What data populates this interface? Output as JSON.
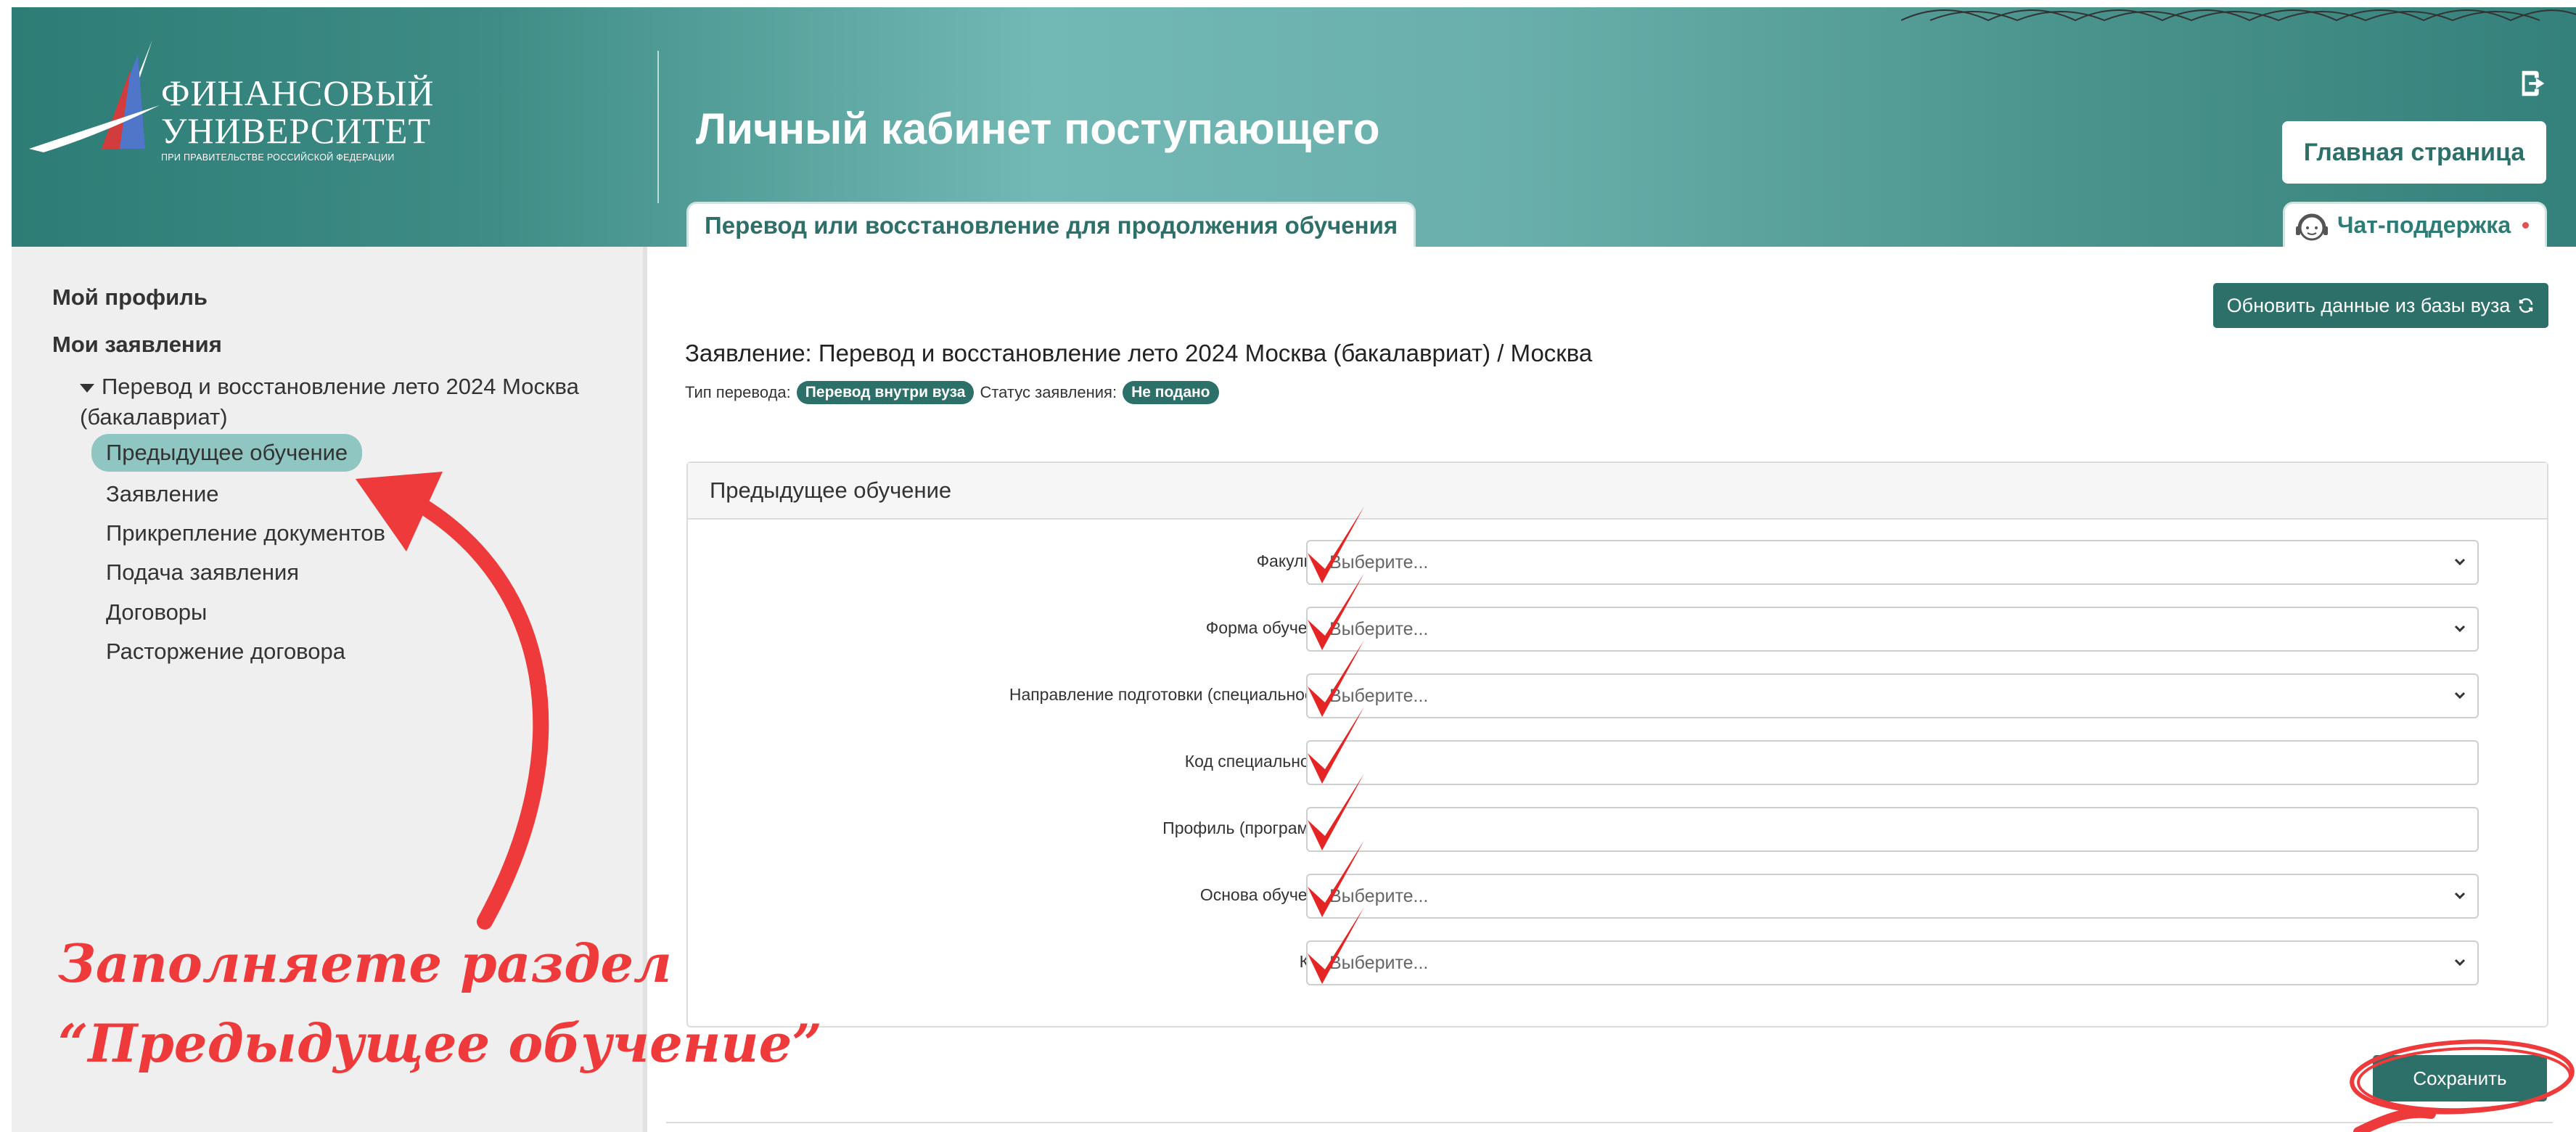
{
  "header": {
    "logo_line1": "ФИНАНСОВЫЙ",
    "logo_line2": "УНИВЕРСИТЕТ",
    "logo_sub": "ПРИ ПРАВИТЕЛЬСТВЕ РОССИЙСКОЙ ФЕДЕРАЦИИ",
    "portal_title": "Личный кабинет поступающего",
    "home_button": "Главная страница",
    "active_tab": "Перевод или восстановление для продолжения обучения",
    "chat_tab": "Чат-поддержка"
  },
  "sidebar": {
    "profile": "Мой профиль",
    "applications": "Мои заявления",
    "application_item": "Перевод и восстановление лето 2024 Москва (бакалавриат)",
    "sub_items": [
      "Предыдущее обучение",
      "Заявление",
      "Прикрепление документов",
      "Подача заявления",
      "Договоры",
      "Расторжение договора"
    ]
  },
  "main": {
    "refresh_button": "Обновить данные из базы вуза",
    "application_title": "Заявление: Перевод и восстановление лето 2024 Москва (бакалавриат) / Москва",
    "transfer_type_label": "Тип перевода:",
    "transfer_type_value": "Перевод внутри вуза",
    "status_label": "Статус заявления:",
    "status_value": "Не подано",
    "panel_title": "Предыдущее обучение",
    "fields": [
      {
        "label": "Факультет:",
        "value": "Выберите...",
        "kind": "select"
      },
      {
        "label": "Форма обучения:",
        "value": "Выберите...",
        "kind": "select"
      },
      {
        "label": "Направление подготовки (специальность):",
        "value": "Выберите...",
        "kind": "select"
      },
      {
        "label": "Код специальности:",
        "value": "",
        "kind": "text"
      },
      {
        "label": "Профиль (программа):",
        "value": "",
        "kind": "text"
      },
      {
        "label": "Основа обучения:",
        "value": "Выберите...",
        "kind": "select"
      },
      {
        "label": "Курс:",
        "value": "Выберите...",
        "kind": "select"
      }
    ],
    "save_button": "Сохранить"
  },
  "annotation": {
    "line1": "Заполняете раздел",
    "line2": "“Предыдущее обучение”"
  },
  "colors": {
    "brand": "#2d6f69",
    "active_item": "#8fc6c1",
    "annotation": "#ee3a3a"
  }
}
